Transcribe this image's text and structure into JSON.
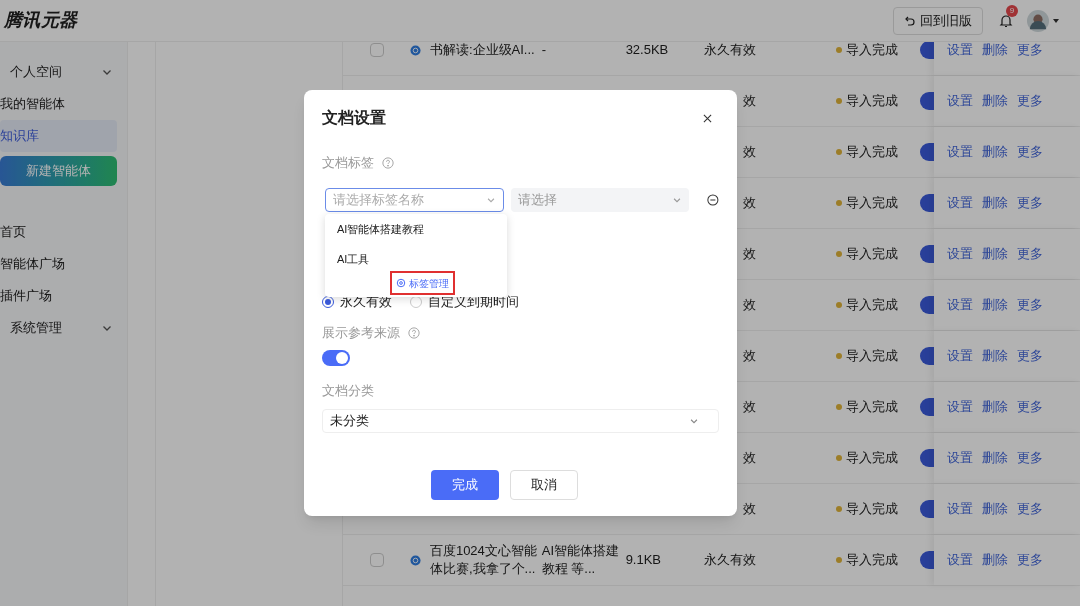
{
  "header": {
    "logo": "腾讯元器",
    "old_version_button": "回到旧版",
    "notification_badge": "9"
  },
  "sidebar": {
    "items": [
      {
        "label": "个人空间",
        "kind": "group",
        "selected": false
      },
      {
        "label": "我的智能体",
        "kind": "item",
        "selected": false
      },
      {
        "label": "知识库",
        "kind": "item",
        "selected": true
      },
      {
        "label": "新建智能体",
        "kind": "action",
        "selected": false
      },
      {
        "label": "首页",
        "kind": "item",
        "selected": false
      },
      {
        "label": "智能体广场",
        "kind": "item",
        "selected": false
      },
      {
        "label": "插件广场",
        "kind": "item",
        "selected": false
      },
      {
        "label": "系统管理",
        "kind": "group",
        "selected": false
      }
    ]
  },
  "table": {
    "rows": [
      {
        "checked": false,
        "name": "书解读:企业级AI...",
        "tags": "-",
        "size": "32.5KB",
        "validity": "永久有效",
        "status": "导入完成",
        "enabled": true,
        "actions": [
          "设置",
          "删除",
          "更多"
        ]
      },
      {
        "validity": "效",
        "status": "导入完成",
        "enabled": true,
        "actions": [
          "设置",
          "删除",
          "更多"
        ]
      },
      {
        "validity": "效",
        "status": "导入完成",
        "enabled": true,
        "actions": [
          "设置",
          "删除",
          "更多"
        ]
      },
      {
        "validity": "效",
        "status": "导入完成",
        "enabled": true,
        "actions": [
          "设置",
          "删除",
          "更多"
        ]
      },
      {
        "validity": "效",
        "status": "导入完成",
        "enabled": true,
        "actions": [
          "设置",
          "删除",
          "更多"
        ]
      },
      {
        "validity": "效",
        "status": "导入完成",
        "enabled": true,
        "actions": [
          "设置",
          "删除",
          "更多"
        ]
      },
      {
        "validity": "效",
        "status": "导入完成",
        "enabled": true,
        "actions": [
          "设置",
          "删除",
          "更多"
        ]
      },
      {
        "validity": "效",
        "status": "导入完成",
        "enabled": true,
        "actions": [
          "设置",
          "删除",
          "更多"
        ]
      },
      {
        "validity": "效",
        "status": "导入完成",
        "enabled": true,
        "actions": [
          "设置",
          "删除",
          "更多"
        ]
      },
      {
        "validity": "效",
        "status": "导入完成",
        "enabled": true,
        "actions": [
          "设置",
          "删除",
          "更多"
        ]
      },
      {
        "checked": false,
        "name": "百度1024文心智能体比赛,我拿了个...",
        "tags": "AI智能体搭建教程 等...",
        "size": "9.1KB",
        "validity": "永久有效",
        "status": "导入完成",
        "enabled": true,
        "actions": [
          "设置",
          "删除",
          "更多"
        ]
      }
    ]
  },
  "dialog": {
    "title": "文档设置",
    "tag_label": "文档标签",
    "tag_name_select": {
      "placeholder": "请选择标签名称"
    },
    "tag_value_select": {
      "placeholder": "请选择",
      "disabled": true
    },
    "tag_dropdown": {
      "options": [
        "AI智能体搭建教程",
        "AI工具"
      ],
      "manage_link": "标签管理"
    },
    "validity_options": [
      {
        "label": "永久有效",
        "selected": true
      },
      {
        "label": "自定义到期时间",
        "selected": false
      }
    ],
    "show_source_label": "展示参考来源",
    "show_source_on": true,
    "category_label": "文档分类",
    "category_value": "未分类",
    "buttons": [
      "完成",
      "取消"
    ]
  }
}
